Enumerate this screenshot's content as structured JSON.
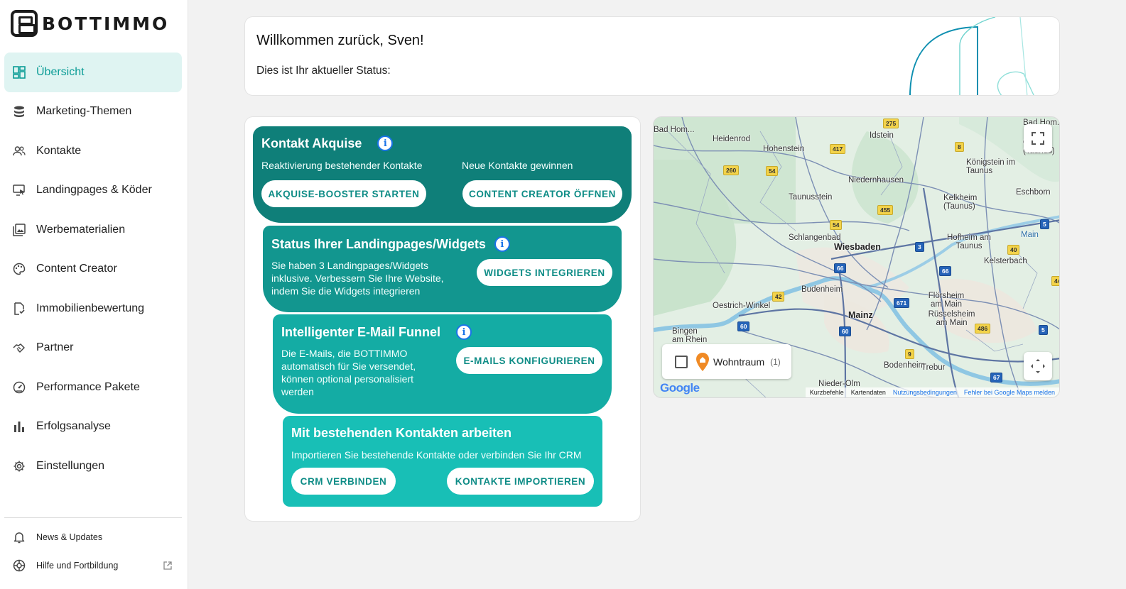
{
  "brand": {
    "name": "BOTTIMMO"
  },
  "sidebar": {
    "items": [
      {
        "label": "Übersicht",
        "icon": "dashboard-icon",
        "active": true
      },
      {
        "label": "Marketing-Themen",
        "icon": "database-icon"
      },
      {
        "label": "Kontakte",
        "icon": "people-icon"
      },
      {
        "label": "Landingpages & Köder",
        "icon": "monitor-pointer-icon"
      },
      {
        "label": "Werbematerialien",
        "icon": "image-gallery-icon"
      },
      {
        "label": "Content Creator",
        "icon": "palette-icon"
      },
      {
        "label": "Immobilienbewertung",
        "icon": "document-check-icon"
      },
      {
        "label": "Partner",
        "icon": "handshake-icon"
      },
      {
        "label": "Performance Pakete",
        "icon": "speedometer-icon"
      },
      {
        "label": "Erfolgsanalyse",
        "icon": "bar-chart-icon"
      },
      {
        "label": "Einstellungen",
        "icon": "gear-icon"
      }
    ],
    "footer": {
      "news": "News & Updates",
      "help": "Hilfe und Fortbildung"
    }
  },
  "welcome": {
    "title": "Willkommen zurück, Sven!",
    "subtitle": "Dies ist Ihr aktueller Status:"
  },
  "funnel": {
    "step1": {
      "title": "Kontakt Akquise",
      "left_text": "Reaktivierung bestehender Kontakte",
      "right_text": "Neue Kontakte gewinnen",
      "left_button": "AKQUISE-BOOSTER STARTEN",
      "right_button": "CONTENT CREATOR ÖFFNEN"
    },
    "step2": {
      "title": "Status Ihrer Landingpages/Widgets",
      "text": "Sie haben 3 Landingpages/Widgets inklusive. Verbessern Sie Ihre Website, indem Sie die Widgets integrieren",
      "button": "WIDGETS INTEGRIEREN"
    },
    "step3": {
      "title": "Intelligenter E-Mail Funnel",
      "text": "Die E-Mails, die BOTTIMMO automatisch für Sie versendet, können optional personalisiert werden",
      "button": "E-MAILS KONFIGURIEREN"
    },
    "step4": {
      "title": "Mit bestehenden Kontakten arbeiten",
      "text": "Importieren Sie bestehende Kontakte oder verbinden Sie Ihr CRM",
      "left_button": "CRM VERBINDEN",
      "right_button": "KONTAKTE IMPORTIEREN"
    },
    "colors": {
      "step1": "#0f7f79",
      "step2": "#12968f",
      "step3": "#14aca4",
      "step4": "#18bfb6",
      "info": "#1a73e8"
    }
  },
  "map": {
    "places": [
      {
        "name": "Heidenrod"
      },
      {
        "name": "Idstein"
      },
      {
        "name": "Hohenstein"
      },
      {
        "name": "Königstein im Taunus"
      },
      {
        "name": "Niedernhausen"
      },
      {
        "name": "Taunusstein"
      },
      {
        "name": "Kelkheim (Taunus)"
      },
      {
        "name": "Eschborn"
      },
      {
        "name": "Schlangenbad"
      },
      {
        "name": "Wiesbaden"
      },
      {
        "name": "Hofheim am Taunus"
      },
      {
        "name": "Kelsterbach"
      },
      {
        "name": "Budenheim"
      },
      {
        "name": "Oestrich-Winkel"
      },
      {
        "name": "Mainz"
      },
      {
        "name": "Flörsheim am Main"
      },
      {
        "name": "Rüsselsheim am Main"
      },
      {
        "name": "Bingen am Rhein"
      },
      {
        "name": "Bodenheim"
      },
      {
        "name": "Trebur"
      },
      {
        "name": "Nieder-Olm"
      },
      {
        "name": "Main"
      },
      {
        "name": "Bad Hom..."
      },
      {
        "name": "Obe... (Taunus)"
      }
    ],
    "legend_label": "Wohntraum",
    "legend_count": "(1)",
    "attribution": {
      "shortcuts": "Kurzbefehle",
      "mapdata": "Kartendaten",
      "terms": "Nutzungsbedingungen",
      "report": "Fehler bei Google Maps melden"
    },
    "logo": "Google"
  }
}
